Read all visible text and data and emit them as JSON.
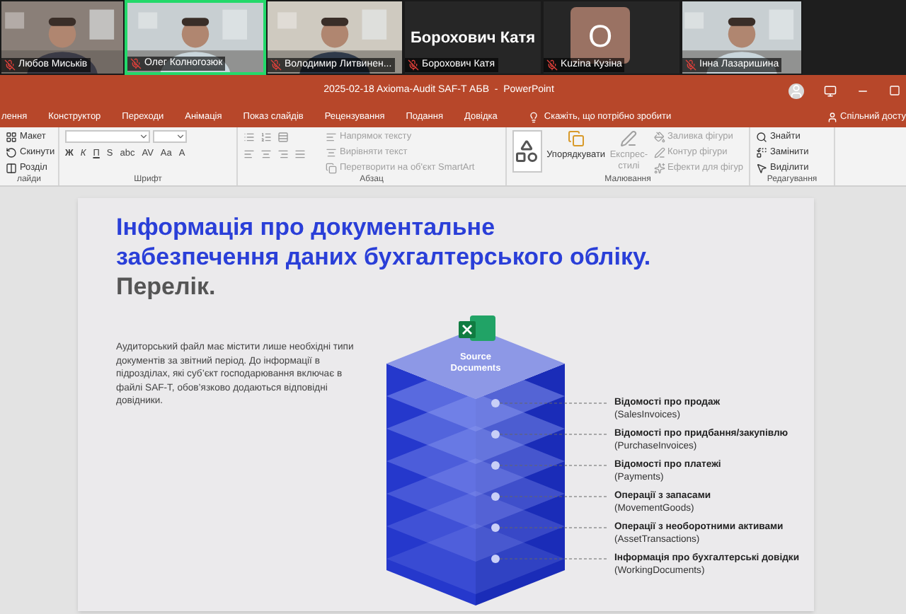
{
  "participants": [
    {
      "name": "Любов Миськів",
      "kind": "video",
      "speaking": false,
      "muted": true
    },
    {
      "name": "Олег Колногозюк",
      "kind": "video",
      "speaking": true,
      "muted": true
    },
    {
      "name": "Володимир Литвинен...",
      "kind": "video",
      "speaking": false,
      "muted": true
    },
    {
      "name": "Борохович Катя",
      "kind": "name",
      "display": "Борохович Катя",
      "speaking": false,
      "muted": true
    },
    {
      "name": "Kuzina Кузіна",
      "kind": "avatar",
      "initial": "О",
      "speaking": false,
      "muted": true
    },
    {
      "name": "Інна Лазаришина",
      "kind": "video",
      "speaking": false,
      "muted": true
    }
  ],
  "window": {
    "title": "2025-02-18 Axioma-Audit SAF-T АБВ  -  PowerPoint"
  },
  "tabs": [
    {
      "label": "лення",
      "selected": false
    },
    {
      "label": "Конструктор",
      "selected": false
    },
    {
      "label": "Переходи",
      "selected": false
    },
    {
      "label": "Анімація",
      "selected": false
    },
    {
      "label": "Показ слайдів",
      "selected": false
    },
    {
      "label": "Рецензування",
      "selected": false
    },
    {
      "label": "Подання",
      "selected": false
    },
    {
      "label": "Довідка",
      "selected": false
    }
  ],
  "tell_me": "Скажіть, що потрібно зробити",
  "share": "Спільний досту",
  "ribbon": {
    "slides": {
      "label": "лайди",
      "items": [
        "Макет",
        "Скинути",
        "Розділ"
      ]
    },
    "font": {
      "label": "Шрифт",
      "format_buttons": [
        "Ж",
        "К",
        "П",
        "S",
        "abc",
        "AV",
        "Aa",
        "A"
      ]
    },
    "paragraph": {
      "label": "Абзац",
      "commands": [
        {
          "label": "Напрямок тексту",
          "disabled": true
        },
        {
          "label": "Вирівняти текст",
          "disabled": true
        },
        {
          "label": "Перетворити на об'єкт SmartArt",
          "disabled": true
        }
      ]
    },
    "drawing": {
      "label": "Малювання",
      "arrange": "Упорядкувати",
      "quick_styles": {
        "label": "Експрес-стилі",
        "disabled": true
      },
      "commands": [
        {
          "label": "Заливка фігури",
          "disabled": true
        },
        {
          "label": "Контур фігури",
          "disabled": true
        },
        {
          "label": "Ефекти для фігур",
          "disabled": true
        }
      ]
    },
    "editing": {
      "label": "Редагування",
      "commands": [
        "Знайти",
        "Замінити",
        "Виділити"
      ]
    }
  },
  "slide": {
    "title_lines": [
      "Інформація про документальне",
      "забезпечення даних бухгалтерського обліку."
    ],
    "subtitle": "Перелік.",
    "body": "Аудиторський файл має містити лише необхідні типи документів за звітний період.  До інформації в підрозділах, які суб’єкт господарювання включає в файлі SAF-T, обов’язково додаються відповідні довідники.",
    "stack_label": "Source Documents",
    "items": [
      {
        "title": "Відомості про продаж",
        "code": "(SalesInvoices)"
      },
      {
        "title": "Відомості про придбання/закупівлю",
        "code": "(PurchaseInvoices)"
      },
      {
        "title": "Відомості про платежі",
        "code": "(Payments)"
      },
      {
        "title": "Операції з запасами",
        "code": "(MovementGoods)"
      },
      {
        "title": "Операції з необоротними активами",
        "code": "(AssetTransactions)"
      },
      {
        "title": "Інформація про бухгалтерські довідки",
        "code": "(WorkingDocuments)"
      }
    ]
  }
}
